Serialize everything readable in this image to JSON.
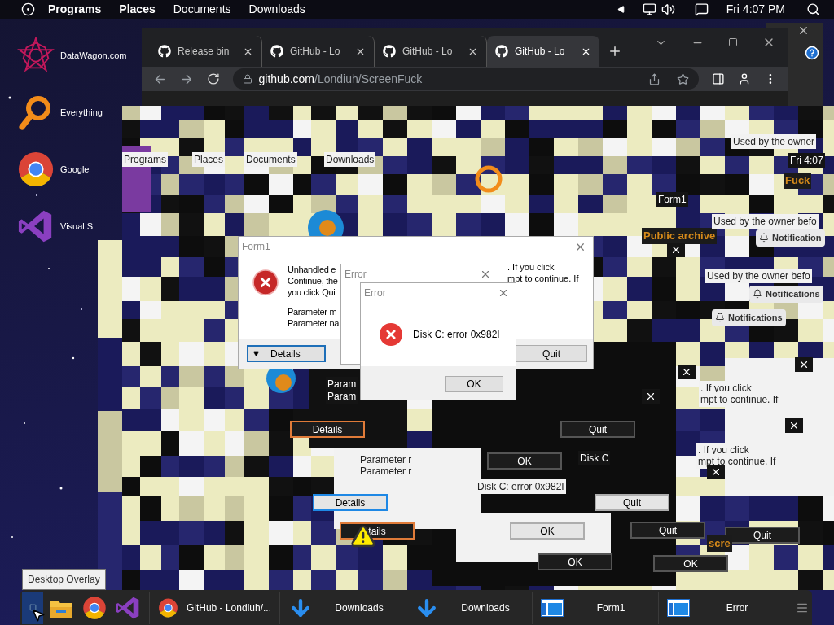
{
  "top_bar": {
    "menus": [
      {
        "label": "Programs",
        "bold": true
      },
      {
        "label": "Places",
        "bold": true
      },
      {
        "label": "Documents",
        "bold": false
      },
      {
        "label": "Downloads",
        "bold": false
      }
    ],
    "clock": "Fri 4:07 PM"
  },
  "desktop_icons": [
    {
      "label": "DataWagon.com",
      "kind": "star"
    },
    {
      "label": "Everything",
      "kind": "magnifier"
    },
    {
      "label": "Google",
      "kind": "chrome"
    },
    {
      "label": "Visual S",
      "kind": "vs"
    }
  ],
  "browser": {
    "tabs": [
      {
        "label": "Release bin",
        "selected": false
      },
      {
        "label": "GitHub - Lo",
        "selected": false
      },
      {
        "label": "GitHub - Lo",
        "selected": false
      },
      {
        "label": "GitHub - Lo",
        "selected": true
      }
    ],
    "address_host": "github.com",
    "address_path": "/Londiuh/ScreenFuck"
  },
  "echoes": [
    {
      "kind": "dark-button",
      "label": "Details",
      "color": "#e07b39"
    },
    {
      "kind": "light-button",
      "label": "Details",
      "color": "#1e88e5"
    },
    {
      "kind": "dark-button",
      "label": "tails",
      "color": "#e07b39"
    },
    {
      "kind": "dark-button",
      "label": "OK",
      "color": "#555555"
    },
    {
      "kind": "light-button",
      "label": "OK",
      "color": "#adadad"
    },
    {
      "kind": "dark-button",
      "label": "OK",
      "color": "#555555"
    },
    {
      "kind": "dark-button",
      "label": "OK",
      "color": "#555555"
    },
    {
      "kind": "dark-button",
      "label": "Quit",
      "color": "#555555"
    },
    {
      "kind": "dark-button",
      "label": "Quit",
      "color": "#555555"
    },
    {
      "kind": "dark-button",
      "label": "Quit",
      "color": "#555555"
    },
    {
      "kind": "light-button",
      "label": "Quit",
      "color": "#adadad"
    },
    {
      "kind": "light-text",
      "label": "Disk C: error 0x982I"
    },
    {
      "kind": "dark-text",
      "label": "Disk C"
    },
    {
      "kind": "dark-text",
      "label": "Param"
    },
    {
      "kind": "dark-text",
      "label": "Param"
    },
    {
      "kind": "light-text",
      "label": "Parameter r"
    },
    {
      "kind": "light-text",
      "label": "Parameter r"
    },
    {
      "kind": "light-text",
      "label": ". If you click"
    },
    {
      "kind": "light-text",
      "label": "mpt to continue. If"
    },
    {
      "kind": "light-text",
      "label": ". If you click"
    },
    {
      "kind": "light-text",
      "label": "mpt to continue. If"
    },
    {
      "kind": "orange-text",
      "label": "Public archive"
    },
    {
      "kind": "orange-text",
      "label": "Fuck"
    },
    {
      "kind": "orange-text",
      "label": "scre"
    },
    {
      "kind": "dark-text",
      "label": "Form1"
    },
    {
      "kind": "light-text",
      "label": "Used by the owner"
    },
    {
      "kind": "light-text",
      "label": "Used by the owner befo"
    },
    {
      "kind": "notify",
      "label": "Notification"
    },
    {
      "kind": "light-text",
      "label": "Used by the owner befo"
    },
    {
      "kind": "notify",
      "label": "Notifications"
    },
    {
      "kind": "notify",
      "label": "Notifications"
    },
    {
      "kind": "light-text",
      "label": "Programs"
    },
    {
      "kind": "light-text",
      "label": "Places"
    },
    {
      "kind": "light-text",
      "label": "Documents"
    },
    {
      "kind": "light-text",
      "label": "Downloads"
    },
    {
      "kind": "dark-text",
      "label": "Fri 4:07"
    },
    {
      "kind": "close"
    },
    {
      "kind": "close"
    },
    {
      "kind": "close"
    },
    {
      "kind": "close"
    },
    {
      "kind": "close"
    },
    {
      "kind": "close"
    }
  ],
  "form1": {
    "title": "Form1",
    "lines": [
      "Unhandled e",
      "Continue, the",
      "you click Qui"
    ],
    "lines_right": [
      ". If you click",
      "mpt to continue. If"
    ],
    "params": [
      "Parameter m",
      "Parameter na"
    ],
    "details": "Details",
    "quit": "Quit"
  },
  "error_back": {
    "title": "Error"
  },
  "error_front": {
    "title": "Error",
    "message": "Disk C: error 0x982I",
    "ok": "OK"
  },
  "tooltip": "Desktop Overlay",
  "taskbar": {
    "tasks": [
      {
        "label": "GitHub - Londiuh/...",
        "kind": "chrome"
      },
      {
        "label": "Downloads",
        "kind": "download"
      },
      {
        "label": "Downloads",
        "kind": "download"
      },
      {
        "label": "Form1",
        "kind": "window"
      },
      {
        "label": "Error",
        "kind": "window"
      }
    ]
  }
}
